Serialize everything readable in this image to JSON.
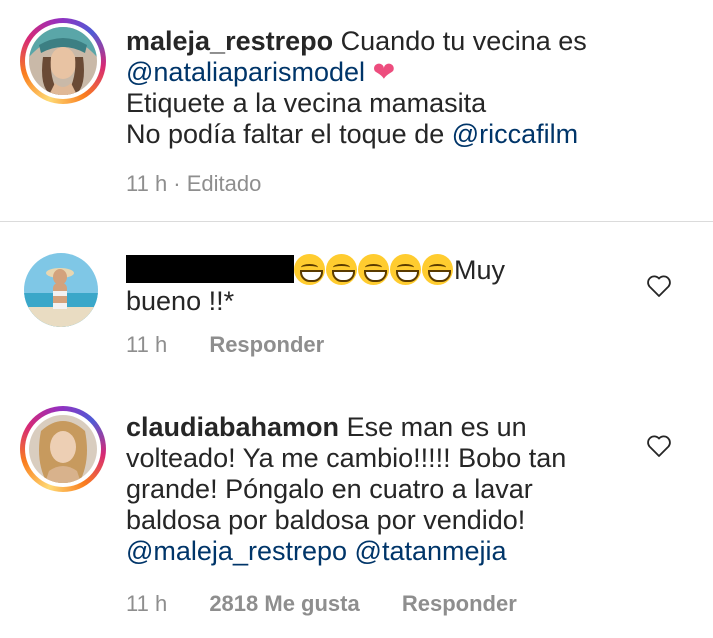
{
  "caption": {
    "username": "maleja_restrepo",
    "text_1": "Cuando tu vecina es",
    "mention_1": "@nataliaparismodel",
    "heart_emoji": "❤",
    "line_3": "Etiquete a la vecina mamasita",
    "line_4_prefix": "No podía faltar el toque de",
    "mention_2": "@riccafilm",
    "time": "11 h · Editado"
  },
  "comments": [
    {
      "username_redacted": true,
      "emoji_count": 5,
      "text_after_emojis": "Muy",
      "text_line_2": "bueno !!*",
      "time": "11 h",
      "reply_label": "Responder"
    },
    {
      "username": "claudiabahamon",
      "text_1": "Ese man es un",
      "text_2": "volteado! Ya me cambio!!!!! Bobo tan",
      "text_3": "grande! Póngalo en cuatro a lavar",
      "text_4": "baldosa por baldosa por vendido!",
      "mention_1": "@maleja_restrepo",
      "mention_2": "@tatanmejia",
      "time": "11 h",
      "likes": "2818 Me gusta",
      "reply_label": "Responder"
    }
  ],
  "colors": {
    "text": "#262626",
    "mention": "#003569",
    "meta": "#8e8e8e",
    "heart": "#ed4d7e",
    "divider": "#dbdbdb"
  }
}
